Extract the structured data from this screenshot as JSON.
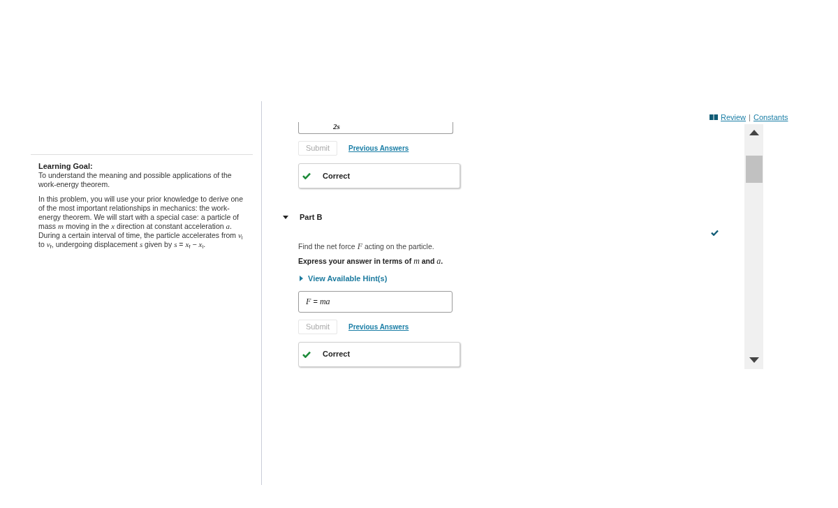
{
  "learning_goal": {
    "heading": "Learning Goal:",
    "text": "To understand the meaning and possible applications of the work-energy theorem."
  },
  "introduction": "In this problem, you will use your prior knowledge to derive one of the most important relationships in mechanics: the work-energy theorem. We will start with a special case: a particle of mass *m* moving in the *x* direction at constant acceleration *a*. During a certain interval of time, the particle accelerates from *v*$_{i}$ to *v*$_{f}$, undergoing displacement *s* given by *s* = *x*$_{f}$ − *x*$_{i}$.",
  "resource_links": {
    "review": "Review",
    "separator": "|",
    "constants": "Constants"
  },
  "parts": [
    {
      "answer": "2s",
      "submit": {
        "label": "Submit",
        "disabled": true
      },
      "previous_answers": "Previous Answers",
      "feedback": {
        "label": "Correct",
        "correct": true
      }
    },
    {
      "title": "Part B",
      "expanded": true,
      "completed": true,
      "prompt": "Find the net force *F* acting on the particle.",
      "instruction": "Express your answer in terms of *m* and *a*.",
      "hint": {
        "label": "View Available Hint(s)",
        "expanded": false
      },
      "answer": "*F* = *ma*",
      "submit": {
        "label": "Submit",
        "disabled": true
      },
      "previous_answers": "Previous Answers",
      "feedback": {
        "label": "Correct",
        "correct": true
      }
    }
  ]
}
